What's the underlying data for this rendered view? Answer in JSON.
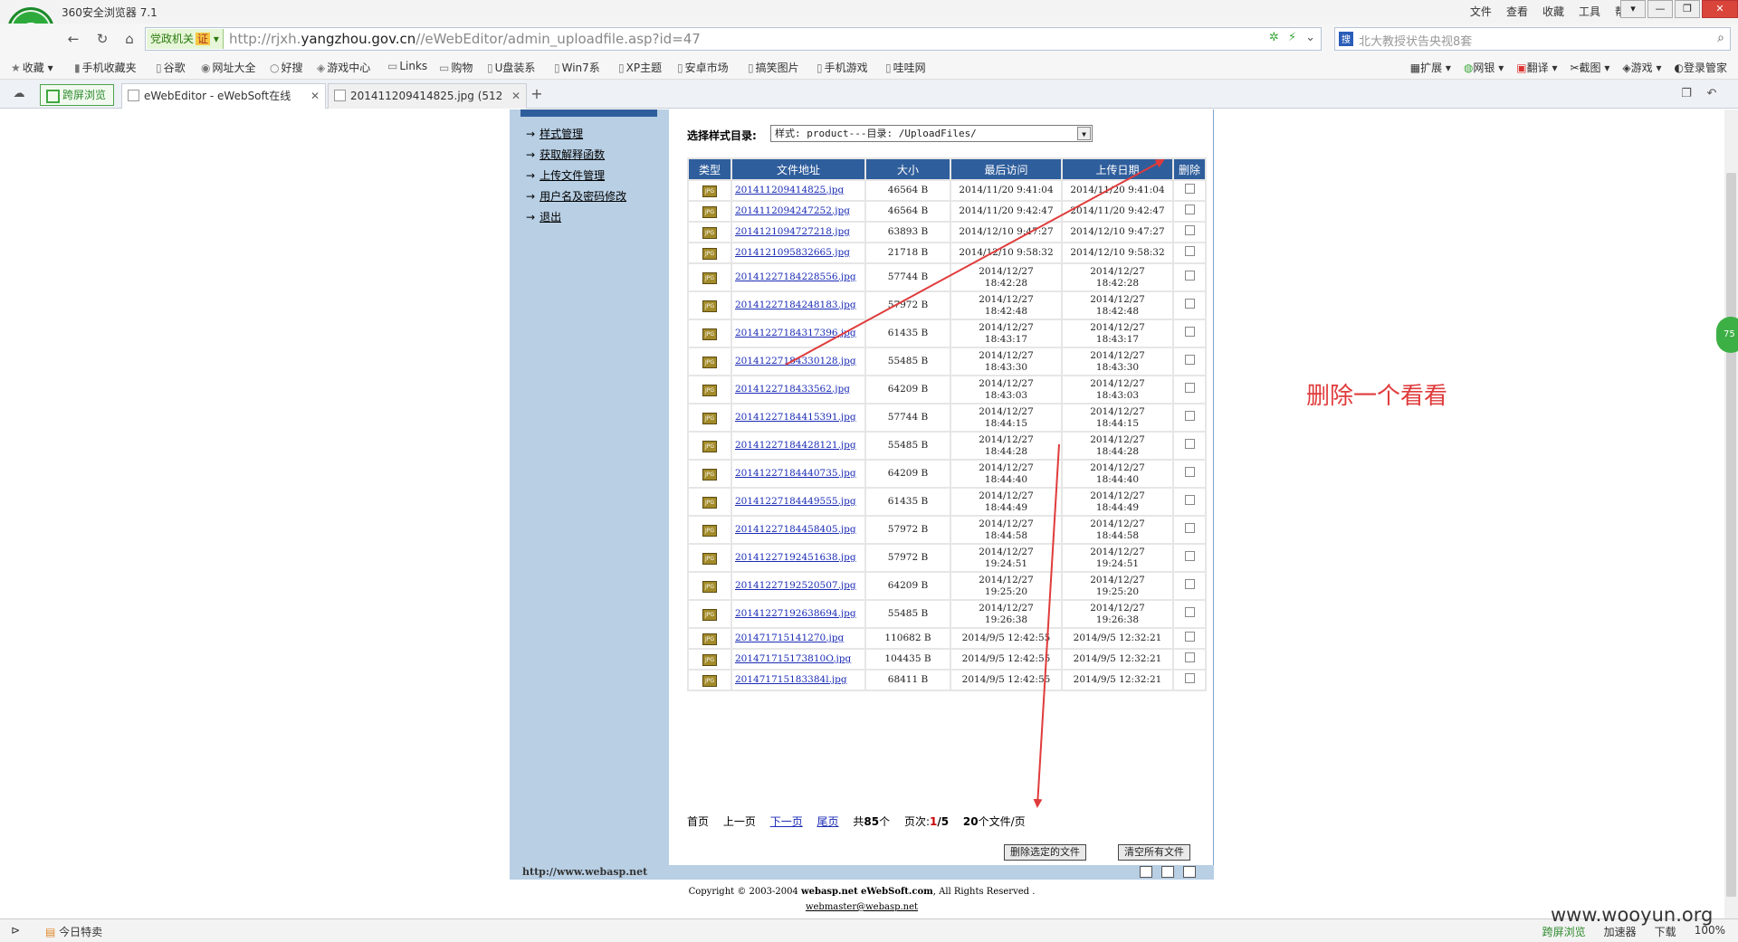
{
  "browser": {
    "app_title": "360安全浏览器 7.1",
    "title_menus": [
      "文件",
      "查看",
      "收藏",
      "工具",
      "帮助"
    ],
    "gov_badge": "党政机关",
    "gov_cert": "证",
    "url_prefix": "http://rjxh.",
    "url_domain": "yangzhou.gov.cn",
    "url_path": "//eWebEditor/admin_uploadfile.asp?id=47",
    "search_placeholder": "北大教授状告央视8套",
    "bookmarks": [
      "收藏",
      "手机收藏夹",
      "谷歌",
      "网址大全",
      "好搜",
      "游戏中心",
      "Links",
      "购物",
      "U盘装系",
      "Win7系",
      "XP主题",
      "安卓市场",
      "搞笑图片",
      "手机游戏",
      "哇哇网"
    ],
    "bookmarks_right": [
      "扩展",
      "网银",
      "翻译",
      "截图",
      "游戏",
      "登录管家"
    ],
    "tab_split_label": "跨屏浏览",
    "tabs": [
      {
        "title": "eWebEditor - eWebSoft在线"
      },
      {
        "title": "201411209414825.jpg (512"
      }
    ],
    "side_float": "75"
  },
  "editor": {
    "menu": [
      {
        "label": "样式管理"
      },
      {
        "label": "获取解释函数"
      },
      {
        "label": "上传文件管理"
      },
      {
        "label": "用户名及密码修改"
      },
      {
        "label": "退出"
      }
    ],
    "dir_label": "选择样式目录:",
    "dir_value": "样式: product---目录: /UploadFiles/",
    "columns": [
      "类型",
      "文件地址",
      "大小",
      "最后访问",
      "上传日期",
      "删除"
    ],
    "files": [
      {
        "name": "201411209414825.jpg",
        "size": "46564 B",
        "access": "2014/11/20 9:41:04",
        "upload": "2014/11/20 9:41:04"
      },
      {
        "name": "2014112094247252.jpg",
        "size": "46564 B",
        "access": "2014/11/20 9:42:47",
        "upload": "2014/11/20 9:42:47"
      },
      {
        "name": "2014121094727218.jpg",
        "size": "63893 B",
        "access": "2014/12/10 9:47:27",
        "upload": "2014/12/10 9:47:27"
      },
      {
        "name": "2014121095832665.jpg",
        "size": "21718 B",
        "access": "2014/12/10 9:58:32",
        "upload": "2014/12/10 9:58:32"
      },
      {
        "name": "20141227184228556.jpg",
        "size": "57744 B",
        "access_date": "2014/12/27",
        "access_time": "18:42:28",
        "upload_date": "2014/12/27",
        "upload_time": "18:42:28"
      },
      {
        "name": "20141227184248183.jpg",
        "size": "57972 B",
        "access_date": "2014/12/27",
        "access_time": "18:42:48",
        "upload_date": "2014/12/27",
        "upload_time": "18:42:48"
      },
      {
        "name": "20141227184317396.jpg",
        "size": "61435 B",
        "access_date": "2014/12/27",
        "access_time": "18:43:17",
        "upload_date": "2014/12/27",
        "upload_time": "18:43:17"
      },
      {
        "name": "20141227184330128.jpg",
        "size": "55485 B",
        "access_date": "2014/12/27",
        "access_time": "18:43:30",
        "upload_date": "2014/12/27",
        "upload_time": "18:43:30"
      },
      {
        "name": "2014122718433562.jpg",
        "size": "64209 B",
        "access_date": "2014/12/27",
        "access_time": "18:43:03",
        "upload_date": "2014/12/27",
        "upload_time": "18:43:03"
      },
      {
        "name": "20141227184415391.jpg",
        "size": "57744 B",
        "access_date": "2014/12/27",
        "access_time": "18:44:15",
        "upload_date": "2014/12/27",
        "upload_time": "18:44:15"
      },
      {
        "name": "20141227184428121.jpg",
        "size": "55485 B",
        "access_date": "2014/12/27",
        "access_time": "18:44:28",
        "upload_date": "2014/12/27",
        "upload_time": "18:44:28"
      },
      {
        "name": "20141227184440735.jpg",
        "size": "64209 B",
        "access_date": "2014/12/27",
        "access_time": "18:44:40",
        "upload_date": "2014/12/27",
        "upload_time": "18:44:40"
      },
      {
        "name": "20141227184449555.jpg",
        "size": "61435 B",
        "access_date": "2014/12/27",
        "access_time": "18:44:49",
        "upload_date": "2014/12/27",
        "upload_time": "18:44:49"
      },
      {
        "name": "20141227184458405.jpg",
        "size": "57972 B",
        "access_date": "2014/12/27",
        "access_time": "18:44:58",
        "upload_date": "2014/12/27",
        "upload_time": "18:44:58"
      },
      {
        "name": "20141227192451638.jpg",
        "size": "57972 B",
        "access_date": "2014/12/27",
        "access_time": "19:24:51",
        "upload_date": "2014/12/27",
        "upload_time": "19:24:51"
      },
      {
        "name": "20141227192520507.jpg",
        "size": "64209 B",
        "access_date": "2014/12/27",
        "access_time": "19:25:20",
        "upload_date": "2014/12/27",
        "upload_time": "19:25:20"
      },
      {
        "name": "20141227192638694.jpg",
        "size": "55485 B",
        "access_date": "2014/12/27",
        "access_time": "19:26:38",
        "upload_date": "2014/12/27",
        "upload_time": "19:26:38"
      },
      {
        "name": "201471715141270.jpg",
        "size": "110682 B",
        "access": "2014/9/5 12:42:55",
        "upload": "2014/9/5 12:32:21"
      },
      {
        "name": "201471715173810O.jpg",
        "size": "104435 B",
        "access": "2014/9/5 12:42:55",
        "upload": "2014/9/5 12:32:21"
      },
      {
        "name": "201471715183384l.jpg",
        "size": "68411 B",
        "access": "2014/9/5 12:42:55",
        "upload": "2014/9/5 12:32:21"
      }
    ],
    "pager": {
      "first": "首页",
      "prev": "上一页",
      "next": "下一页",
      "last": "尾页",
      "total_pre": "共",
      "total": "85",
      "total_post": "个",
      "page_pre": "页次:",
      "page_cur": "1",
      "page_sep": "/5",
      "per_page": "20",
      "per_page_post": "个文件/页"
    },
    "delete_selected": "删除选定的文件",
    "clear_all": "清空所有文件",
    "footer_site": "http://www.webasp.net",
    "copyright_pre": "Copyright © 2003-2004",
    "copyright_s1": "webasp.net",
    "copyright_s2": "eWebSoft.com",
    "copyright_post": ", All Rights Reserved .",
    "webmaster": "webmaster@webasp.net"
  },
  "annotation": "删除一个看看",
  "status": {
    "today": "今日特卖",
    "right": [
      "跨屏浏览",
      "加速器",
      "下载",
      "100%"
    ]
  },
  "watermark": "www.wooyun.org",
  "colors": {
    "accent": "#2f5e9c",
    "panel": "#b8cfe4",
    "annotation": "#e03b3b",
    "link": "#1a2bb5"
  }
}
